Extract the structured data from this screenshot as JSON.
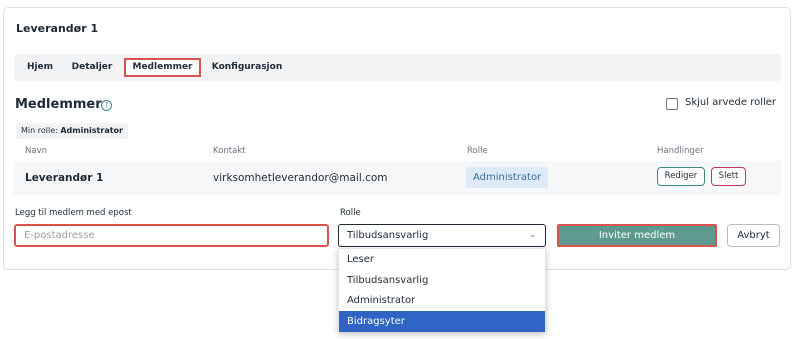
{
  "page": {
    "title": "Leverandør 1"
  },
  "tabs": [
    {
      "label": "Hjem"
    },
    {
      "label": "Detaljer"
    },
    {
      "label": "Medlemmer"
    },
    {
      "label": "Konfigurasjon"
    }
  ],
  "members_section": {
    "title": "Medlemmer",
    "help_icon_glyph": "?",
    "hide_inherited_label": "Skjul arvede roller",
    "my_role_prefix": "Min rolle:",
    "my_role_value": "Administrator"
  },
  "table": {
    "headers": [
      "Navn",
      "Kontakt",
      "Rolle",
      "Handlinger"
    ],
    "rows": [
      {
        "name": "Leverandør 1",
        "contact": "virksomhetleverandor@mail.com",
        "role": "Administrator",
        "edit_label": "Rediger",
        "delete_label": "Slett"
      }
    ]
  },
  "invite_form": {
    "email_label": "Legg til medlem med epost",
    "email_placeholder": "E-postadresse",
    "email_value": "",
    "role_label": "Rolle",
    "role_selected": "Tilbudsansvarlig",
    "role_options": [
      "Leser",
      "Tilbudsansvarlig",
      "Administrator",
      "Bidragsyter"
    ],
    "highlighted_option": "Bidragsyter",
    "invite_label": "Inviter medlem",
    "cancel_label": "Avbryt"
  },
  "colors": {
    "accent_teal": "#5e9a8f",
    "highlight_red": "#d9534f",
    "delete_border": "#c93267",
    "option_selected": "#2f63c4"
  }
}
